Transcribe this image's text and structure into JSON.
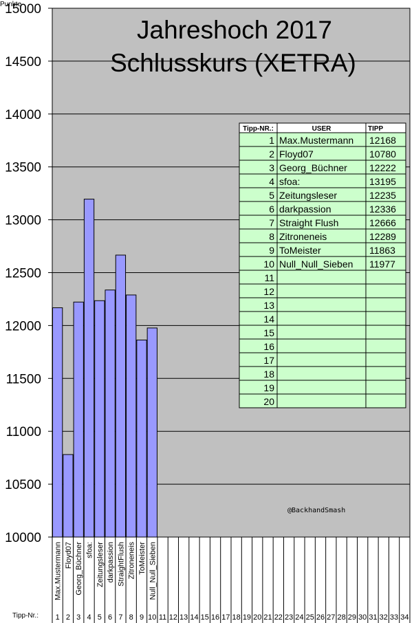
{
  "title_line1": "Jahreshoch 2017",
  "title_line2": "Schlusskurs (XETRA)",
  "y_unit_label": "Punkte",
  "x_row_label": "Tipp-Nr.:",
  "watermark": "@BackhandSmash",
  "colors": {
    "plot_bg": "#c0c0c0",
    "bar_fill": "#9999ff",
    "table_bg": "#ccffcc",
    "gridline": "#000000"
  },
  "table": {
    "headers": [
      "Tipp-NR.:",
      "USER",
      "TIPP"
    ],
    "rows": [
      {
        "nr": "1",
        "user": "Max.Mustermann",
        "tipp": "12168"
      },
      {
        "nr": "2",
        "user": "Floyd07",
        "tipp": "10780"
      },
      {
        "nr": "3",
        "user": "Georg_Büchner",
        "tipp": "12222"
      },
      {
        "nr": "4",
        "user": "sfoa:",
        "tipp": "13195"
      },
      {
        "nr": "5",
        "user": "Zeitungsleser",
        "tipp": "12235"
      },
      {
        "nr": "6",
        "user": "darkpassion",
        "tipp": "12336"
      },
      {
        "nr": "7",
        "user": "Straight Flush",
        "tipp": "12666"
      },
      {
        "nr": "8",
        "user": "Zitroneneis",
        "tipp": "12289"
      },
      {
        "nr": "9",
        "user": "ToMeister",
        "tipp": "11863"
      },
      {
        "nr": "10",
        "user": "Null_Null_Sieben",
        "tipp": "11977"
      },
      {
        "nr": "11",
        "user": "",
        "tipp": ""
      },
      {
        "nr": "12",
        "user": "",
        "tipp": ""
      },
      {
        "nr": "13",
        "user": "",
        "tipp": ""
      },
      {
        "nr": "14",
        "user": "",
        "tipp": ""
      },
      {
        "nr": "15",
        "user": "",
        "tipp": ""
      },
      {
        "nr": "16",
        "user": "",
        "tipp": ""
      },
      {
        "nr": "17",
        "user": "",
        "tipp": ""
      },
      {
        "nr": "18",
        "user": "",
        "tipp": ""
      },
      {
        "nr": "19",
        "user": "",
        "tipp": ""
      },
      {
        "nr": "20",
        "user": "",
        "tipp": ""
      }
    ]
  },
  "chart_data": {
    "type": "bar",
    "title": "Jahreshoch 2017 Schlusskurs (XETRA)",
    "ylabel": "Punkte",
    "ylim": [
      10000,
      15000
    ],
    "yticks": [
      10000,
      10500,
      11000,
      11500,
      12000,
      12500,
      13000,
      13500,
      14000,
      14500,
      15000
    ],
    "grid": true,
    "categories": [
      "Max.Mustermann",
      "Floyd07",
      "Georg_Büchner",
      "sfoa:",
      "Zeitungsleser",
      "darkpassion",
      "StraightFlush",
      "Zitroneneis",
      "ToMeister",
      "Null_Null_Sieben"
    ],
    "numbers": [
      "1",
      "2",
      "3",
      "4",
      "5",
      "6",
      "7",
      "8",
      "9",
      "10",
      "11",
      "12",
      "13",
      "14",
      "15",
      "16",
      "17",
      "18",
      "19",
      "20",
      "21",
      "22",
      "23",
      "24",
      "25",
      "26",
      "27",
      "28",
      "29",
      "30",
      "31",
      "32",
      "33",
      "34"
    ],
    "values": [
      12168,
      10780,
      12222,
      13195,
      12235,
      12336,
      12666,
      12289,
      11863,
      11977
    ]
  }
}
